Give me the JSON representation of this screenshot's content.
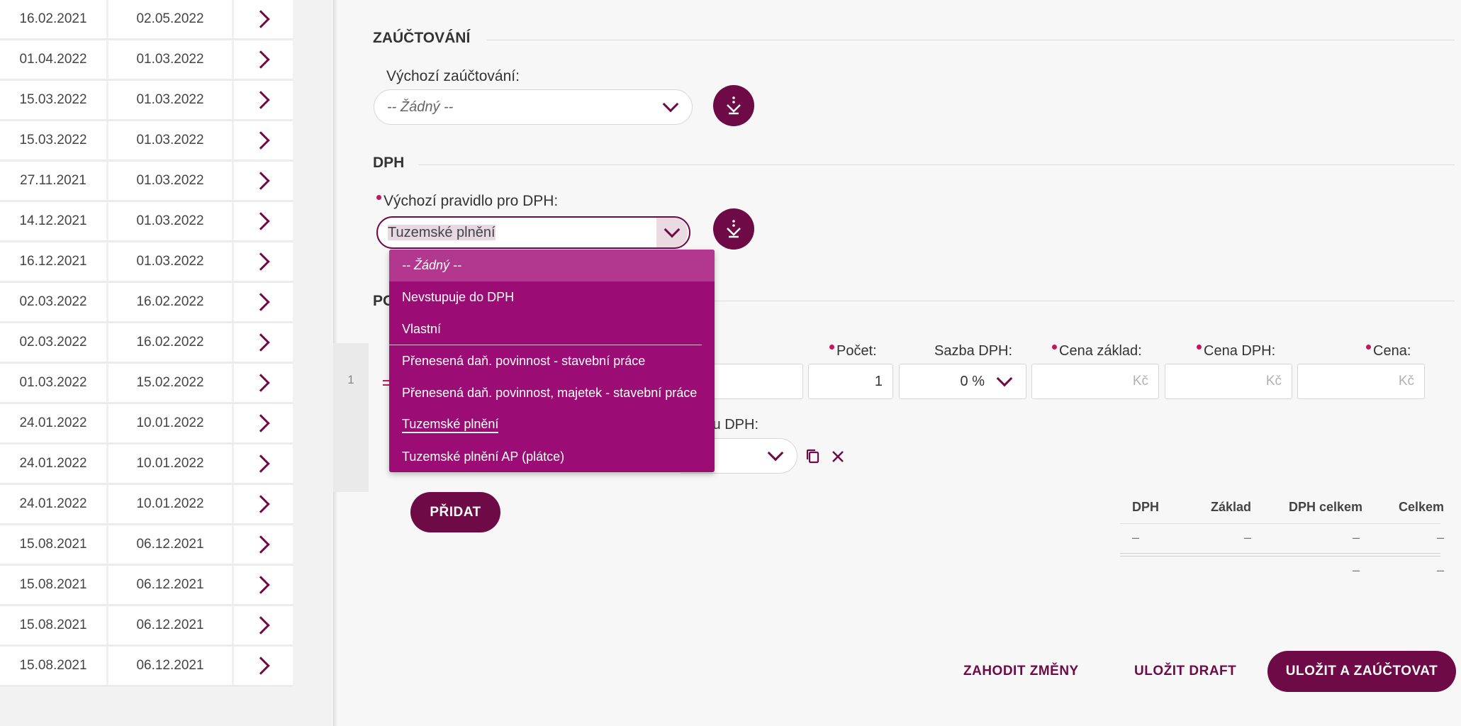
{
  "list": {
    "rows": [
      {
        "d1": "16.02.2021",
        "d2": "02.05.2022"
      },
      {
        "d1": "01.04.2022",
        "d2": "01.03.2022"
      },
      {
        "d1": "15.03.2022",
        "d2": "01.03.2022"
      },
      {
        "d1": "15.03.2022",
        "d2": "01.03.2022"
      },
      {
        "d1": "27.11.2021",
        "d2": "01.03.2022"
      },
      {
        "d1": "14.12.2021",
        "d2": "01.03.2022"
      },
      {
        "d1": "16.12.2021",
        "d2": "01.03.2022"
      },
      {
        "d1": "02.03.2022",
        "d2": "16.02.2022"
      },
      {
        "d1": "02.03.2022",
        "d2": "16.02.2022"
      },
      {
        "d1": "01.03.2022",
        "d2": "15.02.2022"
      },
      {
        "d1": "24.01.2022",
        "d2": "10.01.2022"
      },
      {
        "d1": "24.01.2022",
        "d2": "10.01.2022"
      },
      {
        "d1": "24.01.2022",
        "d2": "10.01.2022"
      },
      {
        "d1": "15.08.2021",
        "d2": "06.12.2021"
      },
      {
        "d1": "15.08.2021",
        "d2": "06.12.2021"
      },
      {
        "d1": "15.08.2021",
        "d2": "06.12.2021"
      },
      {
        "d1": "15.08.2021",
        "d2": "06.12.2021"
      }
    ]
  },
  "zauctovani": {
    "title": "ZAÚČTOVÁNÍ",
    "label": "Výchozí zaúčtování:",
    "value": "-- Žádný --"
  },
  "dph": {
    "title": "DPH",
    "label": "Výchozí pravidlo pro DPH:",
    "value": "Tuzemské plnění"
  },
  "dropdown": {
    "options": [
      "-- Žádný --",
      "Nevstupuje do DPH",
      "Vlastní",
      "Přenesená daň. povinnost - stavební práce",
      "Přenesená daň. povinnost, majetek - stavební práce",
      "Tuzemské plnění",
      "Tuzemské plnění AP (plátce)"
    ]
  },
  "polozky": {
    "title_partial": "PO",
    "line_number": "1",
    "labels": {
      "pocet": "Počet:",
      "sazba": "Sazba DPH:",
      "cena_zaklad": "Cena základ:",
      "cena_dph": "Cena DPH:",
      "cena": "Cena:",
      "rezim_partial": "tu DPH:"
    },
    "values": {
      "pocet": "1",
      "sazba": "0 %",
      "currency": "Kč"
    },
    "add_button": "PŘIDAT"
  },
  "summary": {
    "headers": [
      "DPH",
      "Základ",
      "DPH celkem",
      "Celkem"
    ],
    "row": [
      "–",
      "–",
      "–",
      "–"
    ],
    "total": [
      "–",
      "–"
    ]
  },
  "actions": {
    "discard": "ZAHODIT ZMĚNY",
    "draft": "ULOŽIT DRAFT",
    "save": "ULOŽIT A ZAÚČTOVAT"
  },
  "colors": {
    "primary": "#6e0a45",
    "dropdown": "#9b0c74",
    "required": "#c2185b"
  }
}
